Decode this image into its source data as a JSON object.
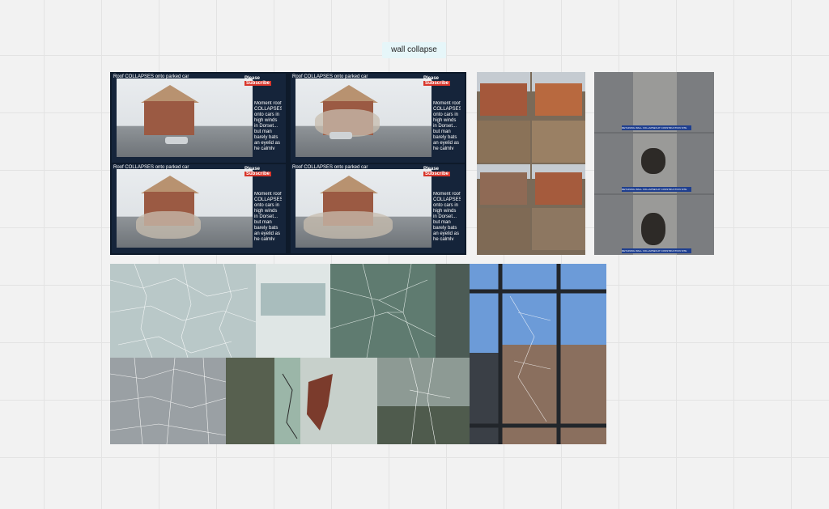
{
  "board": {
    "sticky_note": "wall collapse"
  },
  "roof_video": {
    "caption": "Roof COLLAPSES onto parked car",
    "please": "Please",
    "subscribe": "Subscribe",
    "side_text": "Moment roof COLLAPSES onto cars in high winds in Dorset... but man barely bats an eyelid as he calmly walks past"
  },
  "retaining_wall": {
    "ticker": "RETAINING WALL COLLAPSES AT CONSTRUCTION SITE"
  }
}
